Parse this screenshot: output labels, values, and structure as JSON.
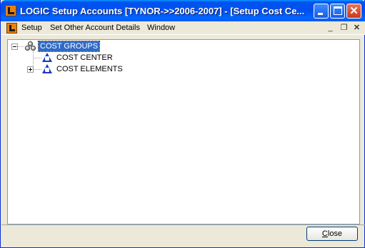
{
  "window": {
    "title": "LOGIC Setup Accounts  [TYNOR->>2006-2007] - [Setup Cost  Ce...",
    "icon": "logic-app-icon"
  },
  "menu": {
    "items": [
      "Setup",
      "Set Other Account Details",
      "Window"
    ],
    "mdi_controls": [
      "minimize-icon",
      "restore-icon",
      "close-icon"
    ]
  },
  "tree": {
    "root": {
      "label": "COST GROUPS",
      "icon": "group-icon",
      "expanded": true,
      "selected": true
    },
    "children": [
      {
        "label": "COST CENTER",
        "icon": "triangle-icon",
        "expandable": false
      },
      {
        "label": "COST ELEMENTS",
        "icon": "triangle-icon",
        "expandable": true
      }
    ]
  },
  "footer": {
    "close_label_first": "C",
    "close_label_rest": "lose"
  },
  "colors": {
    "titlebar": "#0053ee",
    "selection": "#316ac5",
    "tree_icon": "#1a3ac0"
  }
}
